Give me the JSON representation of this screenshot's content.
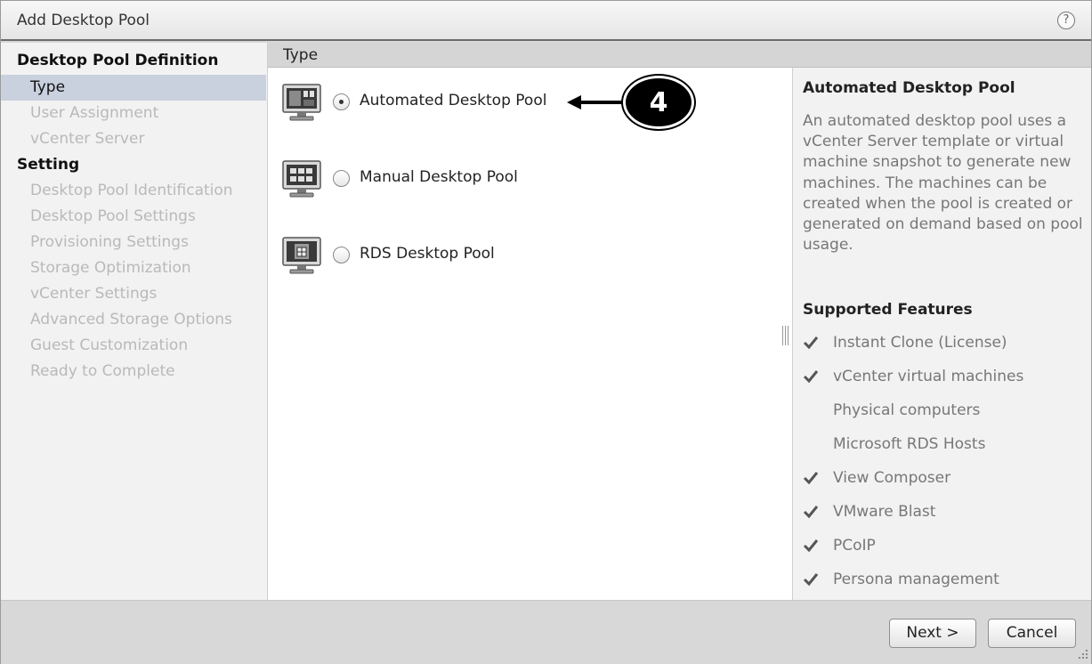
{
  "window": {
    "title": "Add Desktop Pool",
    "help_glyph": "?"
  },
  "nav": {
    "sections": [
      {
        "title": "Desktop Pool Definition",
        "items": [
          {
            "label": "Type",
            "active": true
          },
          {
            "label": "User Assignment",
            "active": false
          },
          {
            "label": "vCenter Server",
            "active": false
          }
        ]
      },
      {
        "title": "Setting",
        "items": [
          {
            "label": "Desktop Pool Identification",
            "active": false
          },
          {
            "label": "Desktop Pool Settings",
            "active": false
          },
          {
            "label": "Provisioning Settings",
            "active": false
          },
          {
            "label": "Storage Optimization",
            "active": false
          },
          {
            "label": "vCenter Settings",
            "active": false
          },
          {
            "label": "Advanced Storage Options",
            "active": false
          },
          {
            "label": "Guest Customization",
            "active": false
          },
          {
            "label": "Ready to Complete",
            "active": false
          }
        ]
      }
    ]
  },
  "main": {
    "header": "Type",
    "options": [
      {
        "label": "Automated Desktop Pool",
        "selected": true,
        "icon": "automated-pool-monitor-icon"
      },
      {
        "label": "Manual Desktop Pool",
        "selected": false,
        "icon": "manual-pool-monitor-icon"
      },
      {
        "label": "RDS Desktop Pool",
        "selected": false,
        "icon": "rds-pool-monitor-icon"
      }
    ],
    "annotation": "4"
  },
  "details": {
    "title": "Automated Desktop Pool",
    "description": "An automated desktop pool uses a vCenter Server template or virtual machine snapshot to generate new machines. The machines can be created when the pool is created or generated on demand based on pool usage.",
    "features_title": "Supported Features",
    "features": [
      {
        "label": "Instant Clone (License)",
        "supported": true
      },
      {
        "label": "vCenter virtual machines",
        "supported": true
      },
      {
        "label": "Physical computers",
        "supported": false
      },
      {
        "label": "Microsoft RDS Hosts",
        "supported": false
      },
      {
        "label": "View Composer",
        "supported": true
      },
      {
        "label": "VMware Blast",
        "supported": true
      },
      {
        "label": "PCoIP",
        "supported": true
      },
      {
        "label": "Persona management",
        "supported": true
      }
    ]
  },
  "footer": {
    "next_label": "Next >",
    "cancel_label": "Cancel"
  },
  "colors": {
    "nav_active_bg": "#c9d1de",
    "disabled_text": "#b9b9b9"
  }
}
